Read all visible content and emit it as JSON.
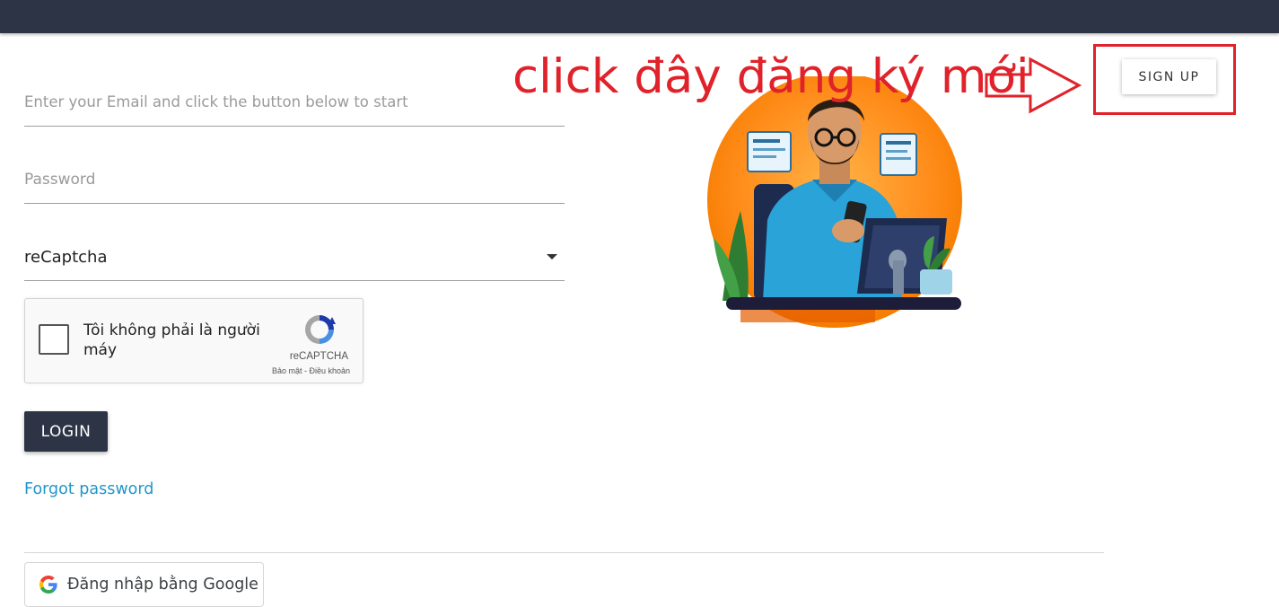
{
  "login_form": {
    "email_placeholder": "Enter your Email and click the button below to start",
    "password_placeholder": "Password",
    "captcha_select_value": "reCaptcha",
    "captcha": {
      "label": "Tôi không phải là người máy",
      "brand": "reCAPTCHA",
      "links": "Bảo mật - Điều khoản"
    },
    "login_label": "LOGIN",
    "forgot_label": "Forgot password",
    "google_label": "Đăng nhập bằng Google"
  },
  "header": {
    "signup_label": "SIGN UP"
  },
  "annotation": {
    "text": "click đây đăng ký mới",
    "color": "#e0222a"
  },
  "colors": {
    "topbar": "#2d3446",
    "link": "#2196c9"
  }
}
